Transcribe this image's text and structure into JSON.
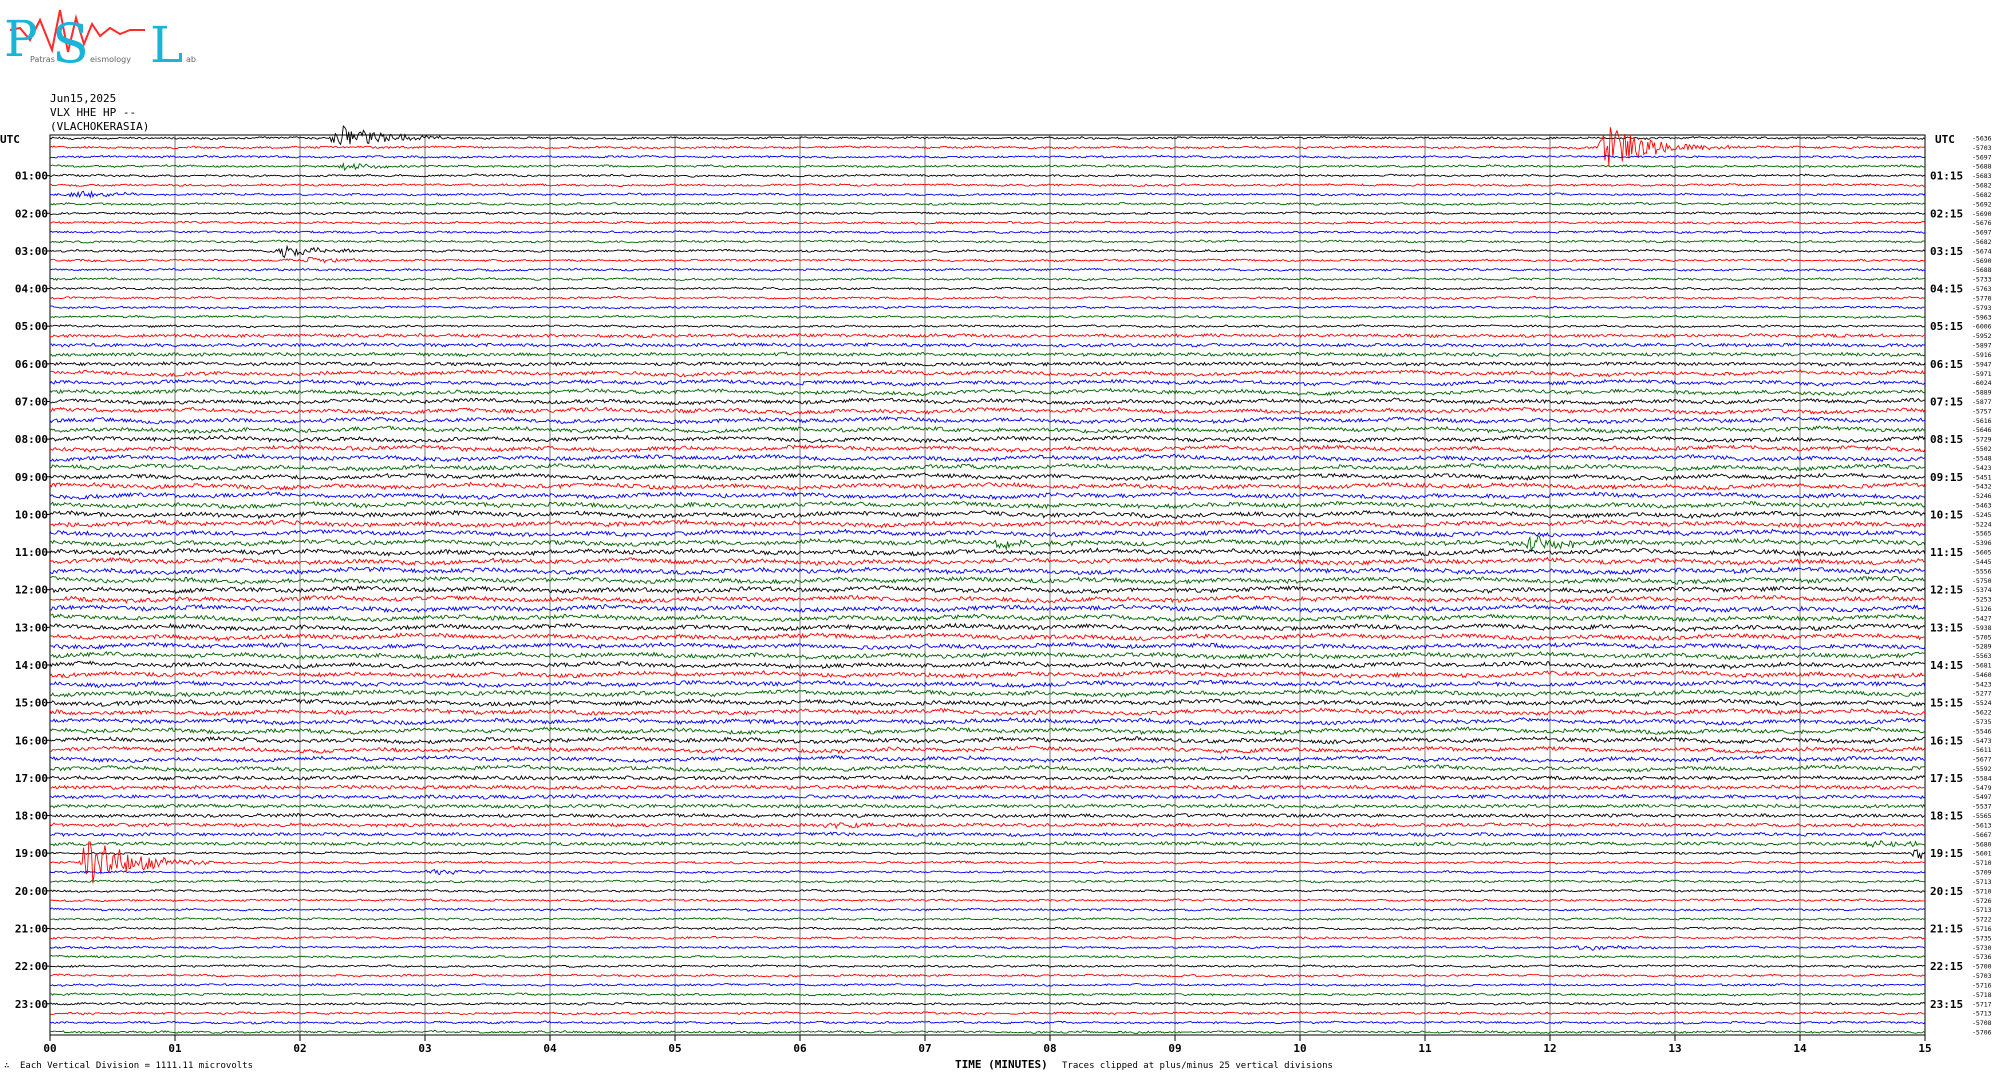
{
  "logo": {
    "initials": [
      "P",
      "S",
      "L"
    ],
    "subtext": [
      "Patras",
      "eismology",
      "ab"
    ]
  },
  "header": {
    "date": "Jun15,2025",
    "channel": "VLX HHE HP --",
    "station": "(VLACHOKERASIA)"
  },
  "chart_data": {
    "type": "line",
    "title": "",
    "corner_label_left": "UTC",
    "corner_label_right": "UTC",
    "xlabel": "TIME (MINUTES)",
    "xlim": [
      0,
      15
    ],
    "x_ticks": [
      "00",
      "01",
      "02",
      "03",
      "04",
      "05",
      "06",
      "07",
      "08",
      "09",
      "10",
      "11",
      "12",
      "13",
      "14",
      "15"
    ],
    "left_hour_labels": [
      "01:00",
      "02:00",
      "03:00",
      "04:00",
      "05:00",
      "06:00",
      "07:00",
      "08:00",
      "09:00",
      "10:00",
      "11:00",
      "12:00",
      "13:00",
      "14:00",
      "15:00",
      "16:00",
      "17:00",
      "18:00",
      "19:00",
      "20:00",
      "21:00",
      "22:00",
      "23:00"
    ],
    "right_hour_labels": [
      "01:15",
      "02:15",
      "03:15",
      "04:15",
      "05:15",
      "06:15",
      "07:15",
      "08:15",
      "09:15",
      "10:15",
      "11:15",
      "12:15",
      "13:15",
      "14:15",
      "15:15",
      "16:15",
      "17:15",
      "18:15",
      "19:15",
      "20:15",
      "21:15",
      "22:15",
      "23:15"
    ],
    "trace_colors": [
      "#000000",
      "#ff0000",
      "#0000ff",
      "#006400"
    ],
    "trace_count": 96,
    "trace_offsets": [
      -5636,
      -5703,
      -5697,
      -5688,
      -5683,
      -5682,
      -5682,
      -5692,
      -5690,
      -5676,
      -5697,
      -5682,
      -5674,
      -5690,
      -5688,
      -5733,
      -5763,
      -5770,
      -5793,
      -5963,
      -6006,
      -5952,
      -5897,
      -5916,
      -5947,
      -5971,
      -6024,
      -5889,
      -5877,
      -5757,
      -5616,
      -5646,
      -5729,
      -5502,
      -5548,
      -5423,
      -5451,
      -5432,
      -5246,
      -5463,
      -5245,
      -5224,
      -5565,
      -5396,
      -5605,
      -5445,
      -5556,
      -5750,
      -5374,
      -5253,
      -5126,
      -5427,
      -5938,
      -5705,
      -5289,
      -5563,
      -5681,
      -5460,
      -5423,
      -5277,
      -5524,
      -5622,
      -5735,
      -5546,
      -5473,
      -5611,
      -5677,
      -5592,
      -5584,
      -5479,
      -5497,
      -5537,
      -5565,
      -5613,
      -5667,
      -5680,
      -5601,
      -5710,
      -5709,
      -5713,
      -5710,
      -5726,
      -5713,
      -5722,
      -5716,
      -5735,
      -5730,
      -5736,
      -5700,
      -5703,
      -5716,
      -5718,
      -5717,
      -5713,
      -5708,
      -5706
    ],
    "events": [
      {
        "trace": 0,
        "minute": 2.25,
        "amplitude": 3.0
      },
      {
        "trace": 1,
        "minute": 12.4,
        "amplitude": 4.5
      },
      {
        "trace": 3,
        "minute": 2.3,
        "amplitude": 0.7
      },
      {
        "trace": 6,
        "minute": 0.15,
        "amplitude": 0.8
      },
      {
        "trace": 12,
        "minute": 1.8,
        "amplitude": 1.3
      },
      {
        "trace": 13,
        "minute": 2.0,
        "amplitude": 0.6
      },
      {
        "trace": 43,
        "minute": 11.8,
        "amplitude": 1.6
      },
      {
        "trace": 43,
        "minute": 7.5,
        "amplitude": 0.9
      },
      {
        "trace": 73,
        "minute": 6.2,
        "amplitude": 0.7
      },
      {
        "trace": 75,
        "minute": 14.5,
        "amplitude": 0.8
      },
      {
        "trace": 76,
        "minute": 14.9,
        "amplitude": 1.2
      },
      {
        "trace": 77,
        "minute": 0.25,
        "amplitude": 6.0
      },
      {
        "trace": 78,
        "minute": 3.0,
        "amplitude": 0.6
      },
      {
        "trace": 86,
        "minute": 12.2,
        "amplitude": 0.6
      }
    ],
    "clip_divisions": 25,
    "grid": true
  },
  "footer": {
    "left": "Each Vertical Division = 1111.11 microvolts",
    "right": "Traces clipped at plus/minus 25 vertical divisions",
    "corner_mark": "∴"
  }
}
